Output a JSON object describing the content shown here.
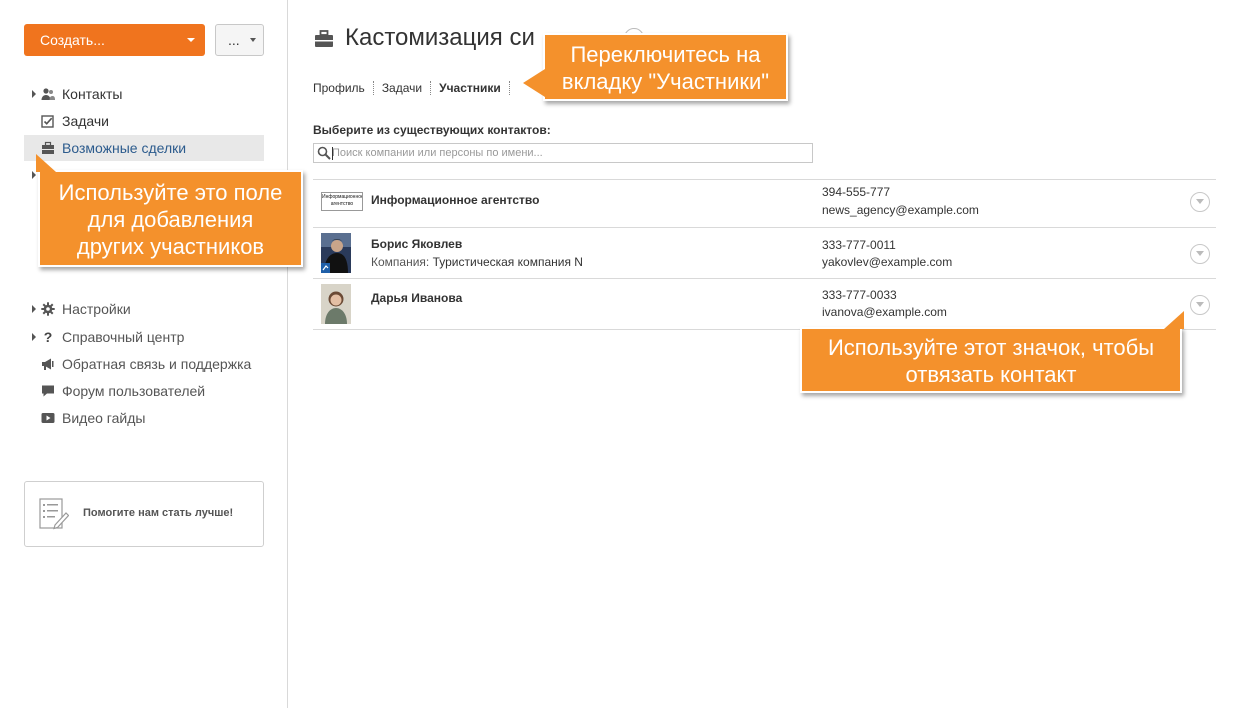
{
  "sidebar": {
    "create_label": "Создать...",
    "more_label": "...",
    "nav": [
      {
        "label": "Контакты",
        "icon": "contacts-icon"
      },
      {
        "label": "Задачи",
        "icon": "tasks-icon"
      },
      {
        "label": "Возможные сделки",
        "icon": "briefcase-icon"
      }
    ],
    "help_nav": [
      {
        "label": "Настройки",
        "icon": "gear-icon"
      },
      {
        "label": "Справочный центр",
        "icon": "question-icon"
      },
      {
        "label": "Обратная связь и поддержка",
        "icon": "megaphone-icon"
      },
      {
        "label": "Форум пользователей",
        "icon": "forum-icon"
      },
      {
        "label": "Видео гайды",
        "icon": "video-icon"
      }
    ],
    "feedback_label": "Помогите нам стать лучше!"
  },
  "main": {
    "title": "Кастомизация си",
    "tabs": [
      {
        "label": "Профиль",
        "active": false
      },
      {
        "label": "Задачи",
        "active": false
      },
      {
        "label": "Участники",
        "active": true
      }
    ],
    "search": {
      "label": "Выберите из существующих контактов:",
      "placeholder": "Поиск компании или персоны по имени..."
    },
    "contacts": [
      {
        "name": "Информационное агентство",
        "logo_text": "Информационное агентство",
        "phone": "394-555-777",
        "email": "news_agency@example.com"
      },
      {
        "name": "Борис Яковлев",
        "company_key": "Компания:",
        "company_value": "Туристическая компания N",
        "phone": "333-777-0011",
        "email": "yakovlev@example.com"
      },
      {
        "name": "Дарья Иванова",
        "phone": "333-777-0033",
        "email": "ivanova@example.com"
      }
    ]
  },
  "callouts": {
    "tab_hint": [
      "Переключитесь на",
      "вкладку \"Участники\""
    ],
    "search_hint": [
      "Используйте это поле",
      "для добавления",
      "других участников"
    ],
    "unlink_hint": [
      "Используйте этот значок, чтобы",
      "отвязать контакт"
    ]
  },
  "colors": {
    "accent": "#f0741e",
    "callout": "#f4912c",
    "active_nav_bg": "#e8e8e8",
    "active_nav_text": "#2c5b8d"
  }
}
